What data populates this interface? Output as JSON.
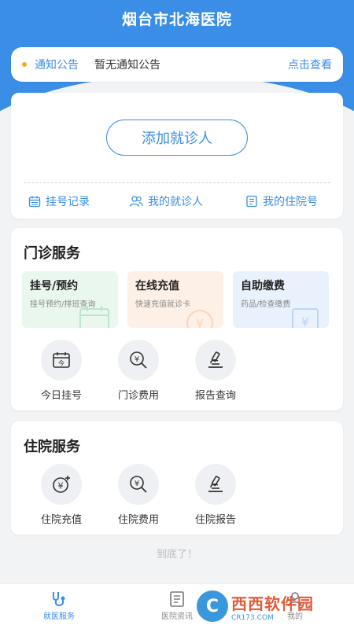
{
  "header": {
    "title": "烟台市北海医院"
  },
  "notice": {
    "label": "通知公告",
    "text": "暂无通知公告",
    "link": "点击查看"
  },
  "patient": {
    "add_button": "添加就诊人",
    "quick_links": [
      {
        "label": "挂号记录",
        "icon": "calendar-icon"
      },
      {
        "label": "我的就诊人",
        "icon": "users-icon"
      },
      {
        "label": "我的住院号",
        "icon": "document-icon"
      }
    ]
  },
  "outpatient": {
    "title": "门诊服务",
    "features": [
      {
        "name": "挂号/预约",
        "desc": "挂号预约/排班查询",
        "bg": "#eaf7ee"
      },
      {
        "name": "在线充值",
        "desc": "快速充值就诊卡",
        "bg": "#fdf0e6"
      },
      {
        "name": "自助缴费",
        "desc": "药品/检查缴费",
        "bg": "#e8f1fc"
      }
    ],
    "items": [
      {
        "label": "今日挂号",
        "icon": "calendar-icon"
      },
      {
        "label": "门诊费用",
        "icon": "fee-search-icon"
      },
      {
        "label": "报告查询",
        "icon": "microscope-icon"
      }
    ]
  },
  "inpatient": {
    "title": "住院服务",
    "items": [
      {
        "label": "住院充值",
        "icon": "recharge-icon"
      },
      {
        "label": "住院费用",
        "icon": "fee-search-icon"
      },
      {
        "label": "住院报告",
        "icon": "microscope-icon"
      }
    ]
  },
  "footer_text": "到底了！",
  "tabbar": {
    "tabs": [
      {
        "label": "就医服务",
        "icon": "stethoscope-icon",
        "active": true
      },
      {
        "label": "医院资讯",
        "icon": "news-icon",
        "active": false
      },
      {
        "label": "我的",
        "icon": "user-icon",
        "active": false
      }
    ]
  },
  "watermark": {
    "logo": "C",
    "main": "西西软件园",
    "sub": "CR173.COM"
  },
  "colors": {
    "primary": "#3a8ee6",
    "notice_dot": "#f5a623"
  }
}
